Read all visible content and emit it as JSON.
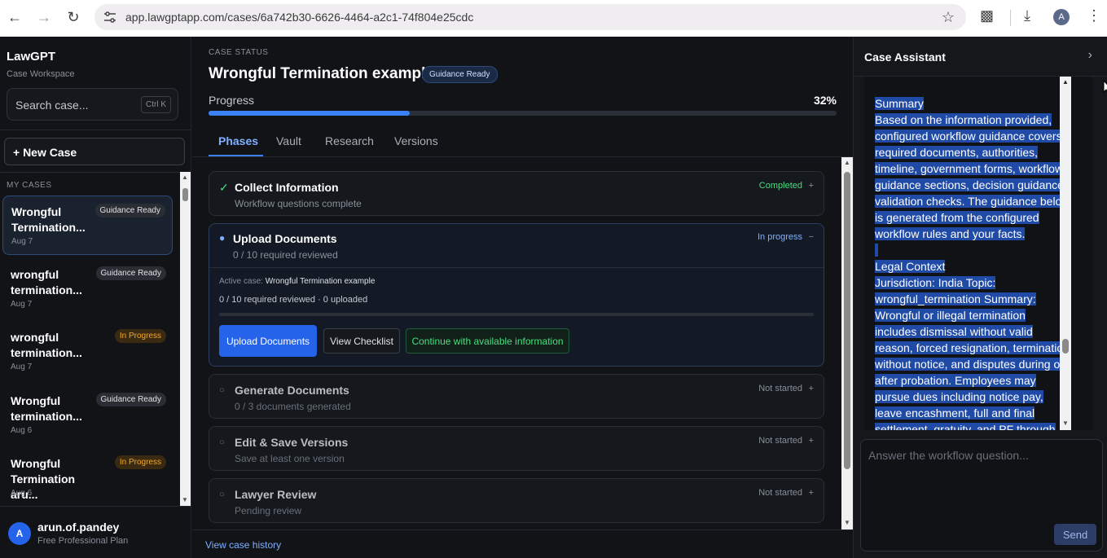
{
  "browser": {
    "url": "app.lawgptapp.com/cases/6a742b30-6626-4464-a2c1-74f804e25cdc",
    "profile_initial": "A"
  },
  "sidebar": {
    "brand": "LawGPT",
    "brand_sub": "Case Workspace",
    "search_placeholder": "Search case...",
    "search_shortcut": "Ctrl K",
    "new_case_label": "+ New Case",
    "my_cases_label": "MY CASES",
    "cases": [
      {
        "title": "Wrongful Termination...",
        "badge": "Guidance Ready",
        "date": "Aug 7"
      },
      {
        "title": "wrongful termination...",
        "badge": "Guidance Ready",
        "date": "Aug 7"
      },
      {
        "title": "wrongful termination...",
        "badge": "In Progress",
        "date": "Aug 7"
      },
      {
        "title": "Wrongful termination...",
        "badge": "Guidance Ready",
        "date": "Aug 6"
      },
      {
        "title": "Wrongful Termination aru...",
        "badge": "In Progress",
        "date": "Aug 6"
      }
    ],
    "user": {
      "initial": "A",
      "name": "arun.of.pandey",
      "plan": "Free Professional Plan"
    }
  },
  "main": {
    "case_status_label": "CASE STATUS",
    "case_title": "Wrongful Termination example",
    "case_badge": "Guidance Ready",
    "progress_label": "Progress",
    "progress_pct_text": "32%",
    "progress_value": 0.32,
    "tabs": [
      "Phases",
      "Vault",
      "Research",
      "Versions"
    ],
    "phases": [
      {
        "title": "Collect Information",
        "sub": "Workflow questions complete",
        "status": "Completed",
        "toggle": "+"
      },
      {
        "title": "Upload Documents",
        "sub": "0 / 10 required reviewed",
        "status": "In progress",
        "toggle": "−",
        "active_case_label": "Active case:",
        "active_case_name": "Wrongful Termination example",
        "count_line": "0 / 10 required reviewed · 0 uploaded",
        "buttons": {
          "upload": "Upload Documents",
          "checklist": "View Checklist",
          "continue": "Continue with available information"
        }
      },
      {
        "title": "Generate Documents",
        "sub": "0 / 3 documents generated",
        "status": "Not started",
        "toggle": "+"
      },
      {
        "title": "Edit & Save Versions",
        "sub": "Save at least one version",
        "status": "Not started",
        "toggle": "+"
      },
      {
        "title": "Lawyer Review",
        "sub": "Pending review",
        "status": "Not started",
        "toggle": "+"
      }
    ],
    "history_link": "View case history"
  },
  "assistant": {
    "title": "Case Assistant",
    "lines": [
      "Summary",
      "Based on the information provided,",
      "configured workflow guidance covers",
      "required documents, authorities,",
      "timeline, government forms, workflow",
      "guidance sections, decision guidance,",
      "validation checks. The guidance below",
      "is generated from the configured",
      "workflow rules and your facts.",
      "",
      "Legal Context",
      "Jurisdiction: India Topic:",
      "wrongful_termination Summary:",
      "Wrongful or illegal termination",
      "includes dismissal without valid",
      "reason, forced resignation, termination",
      "without notice, and disputes during or",
      "after probation. Employees may",
      "pursue dues including notice pay,",
      "leave encashment, full and final",
      "settlement, gratuity, and PF through"
    ],
    "input_placeholder": "Answer the workflow question...",
    "send_label": "Send"
  },
  "colors": {
    "accent": "#3b82f6",
    "completed": "#4ade80",
    "in_progress": "#7fb0ff",
    "warning": "#f5a623"
  }
}
